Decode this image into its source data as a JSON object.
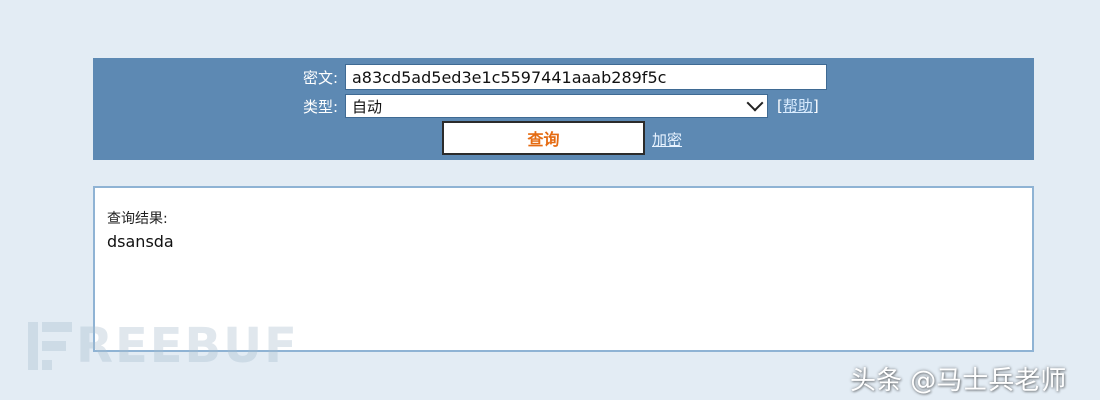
{
  "form": {
    "cipher_label": "密文:",
    "cipher_value": "a83cd5ad5ed3e1c5597441aaab289f5c",
    "type_label": "类型:",
    "type_selected": "自动",
    "help_open": "[",
    "help_label": "帮助",
    "help_close": "]",
    "query_button": "查询",
    "encrypt_link": "加密"
  },
  "result": {
    "title": "查询结果:",
    "value": "dsansda"
  },
  "watermark": {
    "text": "REEBUF"
  },
  "author": "头条 @马士兵老师",
  "colors": {
    "panel_bg": "#5d89b3",
    "page_bg": "#e3ecf4",
    "button_text": "#e56b12"
  }
}
